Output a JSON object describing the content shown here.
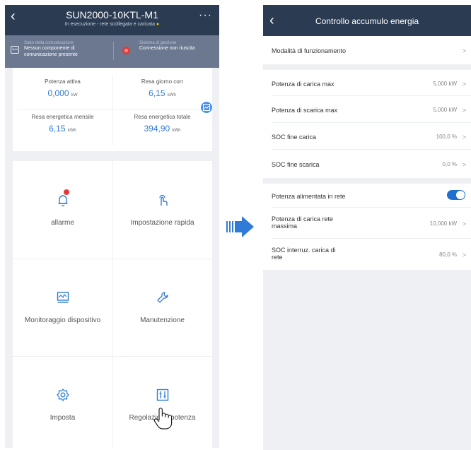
{
  "left_screen": {
    "header": {
      "title": "SUN2000-10KTL-M1",
      "subtitle": "In esecuzione - rete scollegata e caricata",
      "status_dot": "●"
    },
    "status_bar": {
      "comm_label": "Stato della comunicazione",
      "comm_value_1": "Nessun componente di",
      "comm_value_2": "comunicazione presente",
      "mgmt_label": "Sistema di gestione",
      "mgmt_value": "Connessione non riuscita"
    },
    "stats": [
      {
        "label": "Potenza attiva",
        "value": "0,000",
        "unit": "kW"
      },
      {
        "label": "Resa giorno corr",
        "value": "6,15",
        "unit": "kWh"
      },
      {
        "label": "Resa energetica mensile",
        "value": "6,15",
        "unit": "kWh"
      },
      {
        "label": "Resa energetica totale",
        "value": "394,90",
        "unit": "kWh"
      }
    ],
    "tiles": [
      {
        "label": "allarme",
        "icon": "alarm-bell-icon"
      },
      {
        "label": "Impostazione rapida",
        "icon": "tap-finger-icon"
      },
      {
        "label": "Monitoraggio dispositivo",
        "icon": "monitor-icon"
      },
      {
        "label": "Manutenzione",
        "icon": "wrench-icon"
      },
      {
        "label": "Imposta",
        "icon": "gear-icon"
      },
      {
        "label": "Regolazione potenza",
        "icon": "sliders-icon"
      }
    ]
  },
  "right_screen": {
    "header": {
      "title": "Controllo accumulo energia"
    },
    "rows": [
      {
        "label": "Modalità di funzionamento",
        "value": ""
      },
      {
        "label": "Potenza di carica max",
        "value": "5,000 kW"
      },
      {
        "label": "Potenza di scarica max",
        "value": "5,000 kW"
      },
      {
        "label": "SOC fine carica",
        "value": "100,0 %"
      },
      {
        "label": "SOC fine scarica",
        "value": "0,0 %"
      },
      {
        "label": "Potenza alimentata in rete",
        "value": ""
      },
      {
        "label_1": "Potenza di carica rete",
        "label_2": "massima",
        "value": "10,000 kW"
      },
      {
        "label_1": "SOC interruz. carica di",
        "label_2": "rete",
        "value": "80,0 %"
      }
    ],
    "toggle_on": true,
    "chevron": ">"
  },
  "colors": {
    "header_bg": "#2b3b52",
    "status_bg": "#6b7890",
    "accent_blue": "#2f7bd7",
    "toggle_blue": "#1f6fd0",
    "alarm_red": "#e33a3a",
    "page_bg": "#eef0f3"
  }
}
